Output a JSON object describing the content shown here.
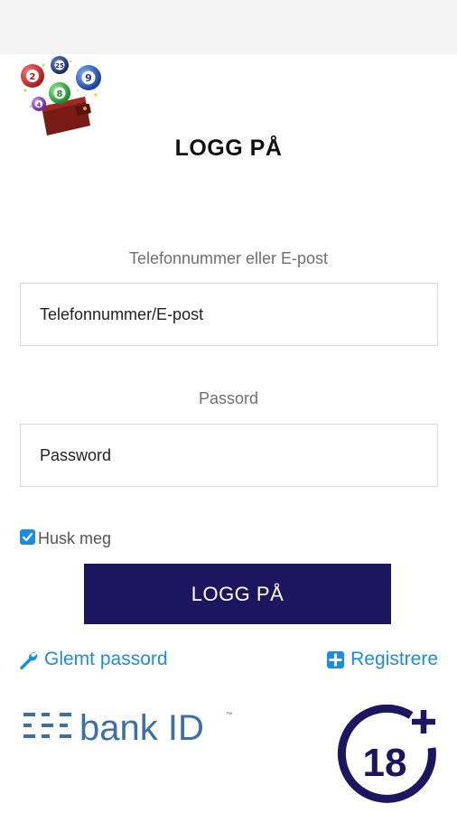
{
  "header": {
    "title": "LOGG PÅ"
  },
  "logo": {
    "balls": [
      "2",
      "25",
      "9",
      "8",
      "4"
    ]
  },
  "form": {
    "phone_label": "Telefonnummer eller E-post",
    "phone_placeholder": "Telefonnummer/E-post",
    "phone_value": "",
    "password_label": "Passord",
    "password_placeholder": "Password",
    "password_value": "",
    "remember_label": "Husk meg",
    "remember_checked": true,
    "submit_label": "LOGG PÅ"
  },
  "links": {
    "forgot_label": "Glemt passord",
    "register_label": "Registrere"
  },
  "footer": {
    "bankid_text": "bank ID",
    "bankid_tm": "™",
    "age_limit": "18"
  },
  "colors": {
    "primary": "#1c1660",
    "link": "#1a8de0",
    "bankid": "#3a6fa8"
  }
}
